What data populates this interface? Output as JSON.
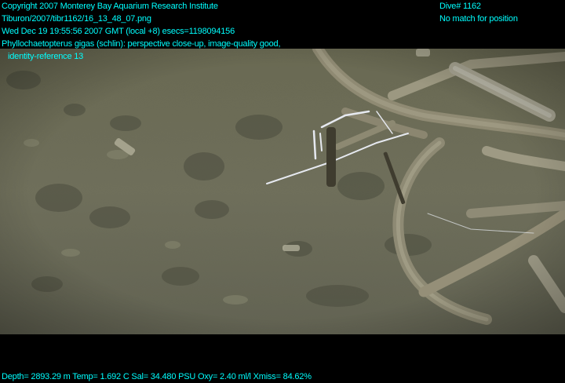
{
  "header": {
    "copyright": "Copyright 2007 Monterey Bay Aquarium Research Institute",
    "file_path": "Tiburon/2007/tibr1162/16_13_48_07.png",
    "timestamp": "Wed Dec 19 19:55:56 2007 GMT (local +8)  esecs=1198094156",
    "annotation_line1": "Phyllochaetopterus gigas (schlin): perspective close-up, image-quality good,",
    "annotation_line2": "identity-reference 13",
    "dive": "Dive# 1162",
    "position": "No match for position"
  },
  "footer": {
    "telemetry": "Depth= 2893.29 m  Temp= 1.692 C  Sal= 34.480 PSU  Oxy= 2.40 ml/l  Xmiss= 84.62%"
  },
  "colors": {
    "overlay_text": "#00ffff",
    "seafloor": "#6c6c5a",
    "tubes": "#9a9580",
    "background": "#000000"
  }
}
